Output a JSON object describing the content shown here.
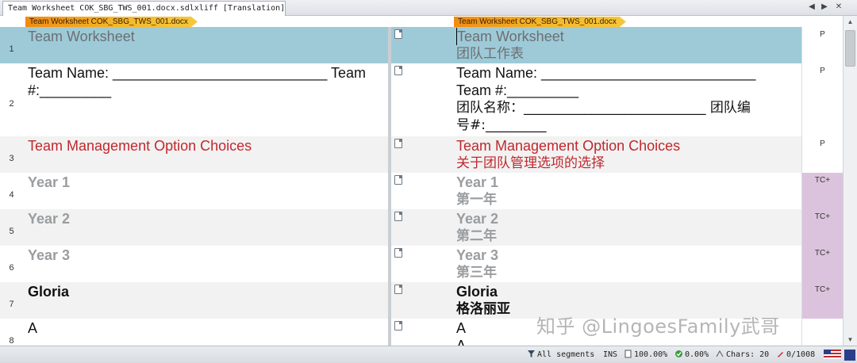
{
  "tab": {
    "title": "Team Worksheet COK_SBG_TWS_001.docx.sdlxliff [Translation]"
  },
  "tab_nav": {
    "prev": "◀",
    "next": "▶",
    "close": "✕"
  },
  "file_tags": {
    "source": "Team Worksheet COK_SBG_TWS_001.docx",
    "target": "Team Worksheet COK_SBG_TWS_001.docx"
  },
  "segments": [
    {
      "num": "1",
      "status": "P",
      "source": [
        "Team Worksheet"
      ],
      "target": [
        "Team Worksheet",
        "团队工作表"
      ]
    },
    {
      "num": "2",
      "status": "P",
      "source": [
        "Team Name: ___________________________ Team",
        "#:_________"
      ],
      "target": [
        "Team Name: ___________________________",
        "Team #:_________",
        "团队名称：___________________________ 团队编",
        "号#:_________"
      ]
    },
    {
      "num": "3",
      "status": "P",
      "source": [
        "Team Management Option Choices"
      ],
      "target": [
        "Team Management Option Choices",
        "关于团队管理选项的选择"
      ]
    },
    {
      "num": "4",
      "status": "TC+",
      "source": [
        "Year 1"
      ],
      "target": [
        "Year 1",
        "第一年"
      ]
    },
    {
      "num": "5",
      "status": "TC+",
      "source": [
        "Year 2"
      ],
      "target": [
        "Year 2",
        "第二年"
      ]
    },
    {
      "num": "6",
      "status": "TC+",
      "source": [
        "Year 3"
      ],
      "target": [
        "Year 3",
        "第三年"
      ]
    },
    {
      "num": "7",
      "status": "TC+",
      "source": [
        "Gloria"
      ],
      "target": [
        "Gloria",
        "格洛丽亚"
      ]
    },
    {
      "num": "8",
      "status": "",
      "source": [
        "A"
      ],
      "target": [
        "A",
        "A"
      ]
    }
  ],
  "statusbar": {
    "filter": "All segments",
    "mode": "INS",
    "percent1": "100.00%",
    "percent2": "0.00%",
    "chars": "Chars: 20",
    "count": "0/1008"
  },
  "watermark": "知乎 @LingoesFamily武哥"
}
